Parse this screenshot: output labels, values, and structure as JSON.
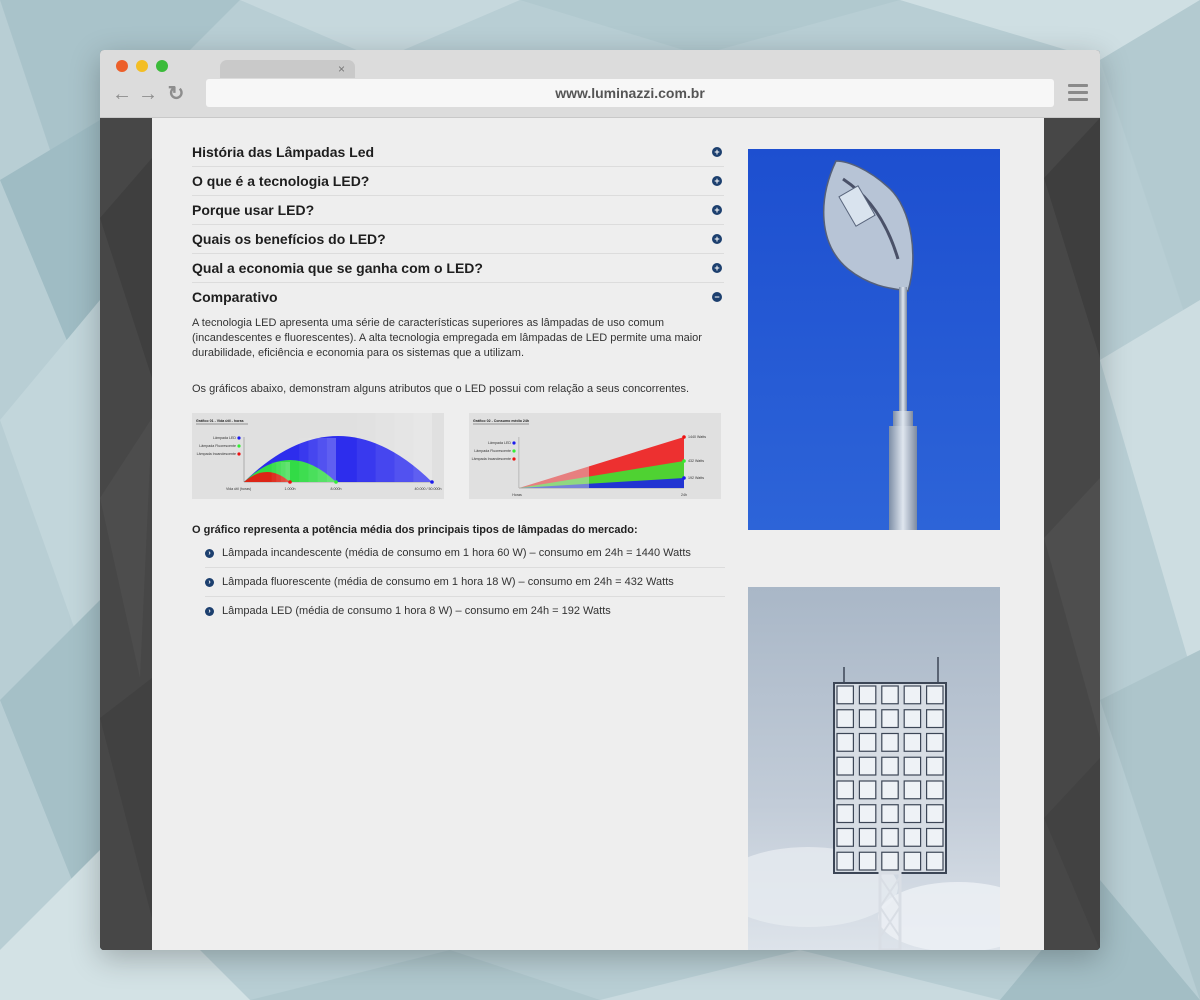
{
  "browser": {
    "url": "www.luminazzi.com.br",
    "tab_close": "×",
    "back": "←",
    "forward": "→",
    "reload": "↻"
  },
  "accordion": {
    "items": [
      {
        "title": "História das Lâmpadas Led",
        "toggle": "+"
      },
      {
        "title": "O que é a tecnologia LED?",
        "toggle": "+"
      },
      {
        "title": "Porque usar LED?",
        "toggle": "+"
      },
      {
        "title": "Quais os benefícios do LED?",
        "toggle": "+"
      },
      {
        "title": "Qual a economia que se ganha com o LED?",
        "toggle": "+"
      },
      {
        "title": "Comparativo",
        "toggle": "−"
      }
    ]
  },
  "comparativo": {
    "paragraph1": "A tecnologia LED apresenta uma série de características superiores as lâmpadas de uso comum (incandescentes e fluorescentes). A alta tecnologia empregada em lâmpadas de LED permite uma maior durabilidade, eficiência e economia para os sistemas que a utilizam.",
    "paragraph2": "Os gráficos abaixo, demonstram alguns atributos que o LED possui com relação a seus concorrentes.",
    "list_heading": "O gráfico representa a potência média dos principais tipos de lâmpadas do mercado:",
    "list": [
      "Lâmpada incandescente (média de consumo em 1 hora 60 W) – consumo em 24h = 1440 Watts",
      "Lâmpada fluorescente (média de consumo em 1 hora 18 W) – consumo em 24h = 432 Watts",
      "Lâmpada LED (média de consumo 1 hora 8 W) – consumo em 24h = 192 Watts"
    ],
    "bullet_glyph": "›"
  },
  "chart_data": [
    {
      "type": "area",
      "title": "Gráfico 01 - Vida útil - horas",
      "xlabel": "Vida útil (horas)",
      "series": [
        {
          "name": "Lâmpada LED",
          "color": "#1a1aee",
          "end": 40000
        },
        {
          "name": "Lâmpada Fluorescente",
          "color": "#33ee33",
          "end": 8000
        },
        {
          "name": "Lâmpada Incandescente",
          "color": "#ee1111",
          "end": 1000
        }
      ],
      "ticks": [
        "1.000h",
        "8.000h",
        "40.000 / 50.000h"
      ]
    },
    {
      "type": "area",
      "title": "Gráfico 02 - Consumo médio 24h",
      "xlabel": "Horas",
      "x_end_label": "24h",
      "series": [
        {
          "name": "Lâmpada LED",
          "color": "#1a1aee",
          "value": 192,
          "label": "192 Watts"
        },
        {
          "name": "Lâmpada Fluorescente",
          "color": "#33ee33",
          "value": 432,
          "label": "432 Watts"
        },
        {
          "name": "Lâmpada Incandescente",
          "color": "#ee1111",
          "value": 1440,
          "label": "1440 Watts"
        }
      ]
    }
  ]
}
